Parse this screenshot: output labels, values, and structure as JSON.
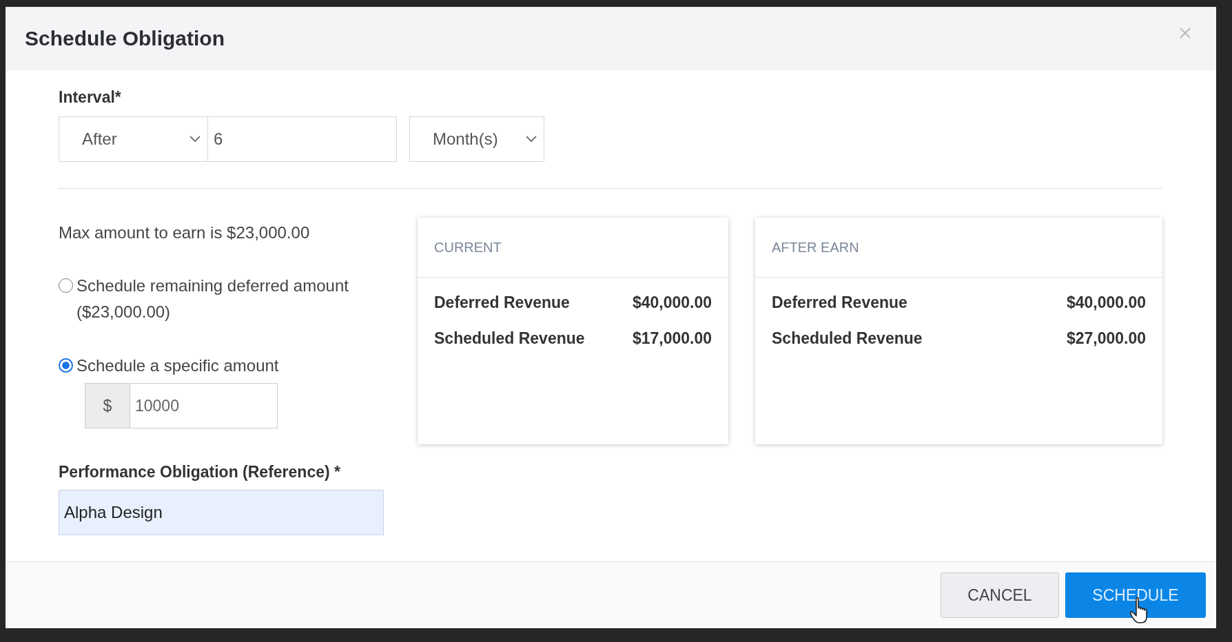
{
  "dialog": {
    "title": "Schedule Obligation"
  },
  "interval": {
    "label": "Interval*",
    "mode": "After",
    "count": "6",
    "unit": "Month(s)"
  },
  "max_text": "Max amount to earn is $23,000.00",
  "options": [
    {
      "label": "Schedule remaining deferred amount ($23,000.00)",
      "selected": false
    },
    {
      "label": "Schedule a specific amount",
      "selected": true
    }
  ],
  "amount": {
    "prefix": "$",
    "value": "10000"
  },
  "reference": {
    "label": "Performance Obligation (Reference) *",
    "value": "Alpha Design"
  },
  "cards": [
    {
      "title": "CURRENT",
      "rows": [
        {
          "label": "Deferred Revenue",
          "value": "$40,000.00"
        },
        {
          "label": "Scheduled Revenue",
          "value": "$17,000.00"
        }
      ]
    },
    {
      "title": "AFTER EARN",
      "rows": [
        {
          "label": "Deferred Revenue",
          "value": "$40,000.00"
        },
        {
          "label": "Scheduled Revenue",
          "value": "$27,000.00"
        }
      ]
    }
  ],
  "buttons": [
    {
      "label": "CANCEL",
      "kind": "secondary"
    },
    {
      "label": "SCHEDULE",
      "kind": "primary"
    }
  ]
}
